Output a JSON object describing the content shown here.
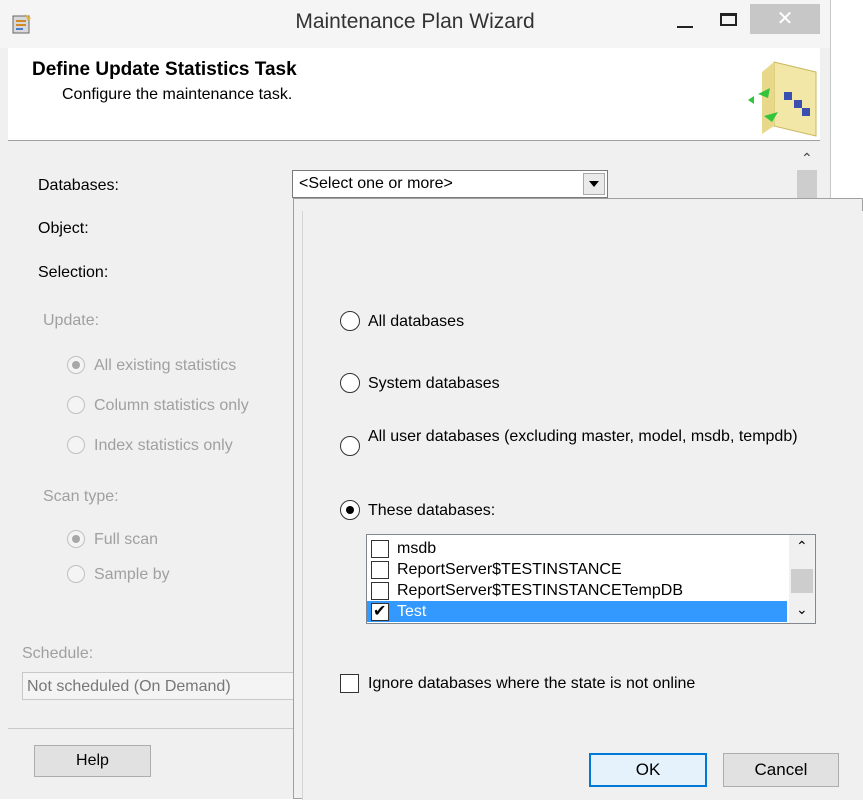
{
  "window": {
    "title": "Maintenance Plan Wizard",
    "close_glyph": "✕"
  },
  "header": {
    "title": "Define Update Statistics Task",
    "subtitle": "Configure the maintenance task."
  },
  "form": {
    "databases_label": "Databases:",
    "databases_value": "<Select one or more>",
    "object_label": "Object:",
    "selection_label": "Selection:",
    "update_label": "Update:",
    "update_options": [
      "All existing statistics",
      "Column statistics only",
      "Index statistics only"
    ],
    "update_selected": "All existing statistics",
    "scan_label": "Scan type:",
    "scan_options": [
      "Full scan",
      "Sample by"
    ],
    "scan_selected": "Full scan",
    "schedule_label": "Schedule:",
    "schedule_value": "Not scheduled (On Demand)"
  },
  "footer": {
    "help_label": "Help"
  },
  "popup": {
    "options": [
      "All databases",
      "System databases",
      "All user databases  (excluding master, model, msdb, tempdb)",
      "These databases:"
    ],
    "selected_option": "These databases:",
    "databases": [
      {
        "name": "msdb",
        "checked": false,
        "selected": false
      },
      {
        "name": "ReportServer$TESTINSTANCE",
        "checked": false,
        "selected": false
      },
      {
        "name": "ReportServer$TESTINSTANCETempDB",
        "checked": false,
        "selected": false
      },
      {
        "name": "Test",
        "checked": true,
        "selected": true
      }
    ],
    "ignore_offline_label": "Ignore databases where the state is not online",
    "ignore_offline_checked": false,
    "ok_label": "OK",
    "cancel_label": "Cancel"
  },
  "icons": {
    "app": "wizard-icon",
    "header": "maintenance-plan-graphic",
    "dropdown": "chevron-down-icon"
  },
  "colors": {
    "selection": "#3399ff",
    "ok_border": "#0078d7",
    "close_bg": "#c7c7c7"
  }
}
